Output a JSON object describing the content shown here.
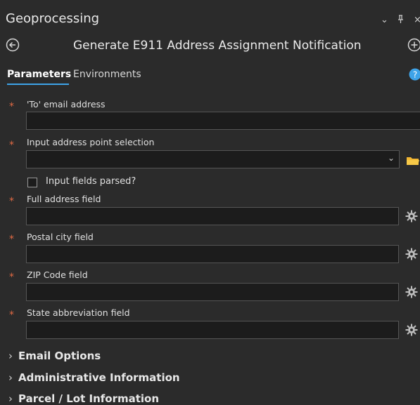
{
  "pane": {
    "title": "Geoprocessing",
    "controls": {
      "menu": "⌄",
      "pin": "ᵖ",
      "close": "×"
    }
  },
  "tool": {
    "name": "Generate E911 Address Assignment Notification"
  },
  "tabs": [
    {
      "label": "Parameters",
      "active": true
    },
    {
      "label": "Environments",
      "active": false
    }
  ],
  "parameters": [
    {
      "label": "'To' email address",
      "required": true,
      "value": ""
    },
    {
      "label": "Input address point selection",
      "required": true,
      "value": ""
    },
    {
      "label": "Full address field",
      "required": true,
      "value": ""
    },
    {
      "label": "Postal city field",
      "required": true,
      "value": ""
    },
    {
      "label": "ZIP Code field",
      "required": true,
      "value": ""
    },
    {
      "label": "State abbreviation field",
      "required": true,
      "value": ""
    }
  ],
  "checkbox": {
    "label": "Input fields parsed?",
    "checked": false
  },
  "required_marker": "*",
  "sections": [
    {
      "label": "Email Options"
    },
    {
      "label": "Administrative Information"
    },
    {
      "label": "Parcel / Lot Information"
    }
  ],
  "colors": {
    "background": "#2b2b2b",
    "field": "#1c1c1c",
    "accent": "#3ea3e8",
    "required": "#e06a44",
    "folder": "#f2b632"
  }
}
